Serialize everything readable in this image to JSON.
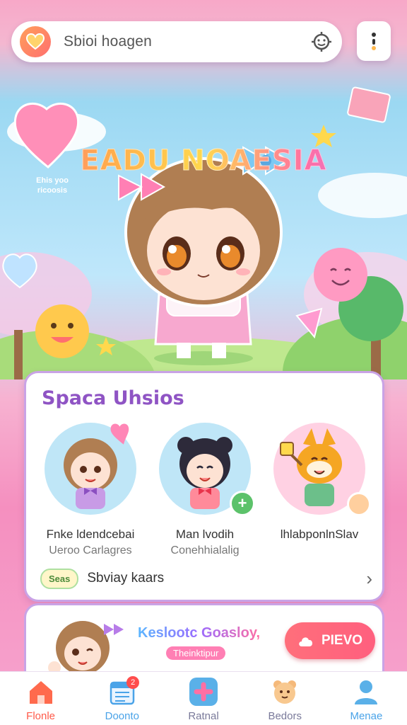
{
  "search": {
    "text": "Sbioi hoagen"
  },
  "hero": {
    "title": "EADU NOAESIA",
    "heart_badge": "Ehis yoo ricoosis"
  },
  "section": {
    "title": "Spaca Uhsios",
    "characters": [
      {
        "name": "Fnke ldendcebai",
        "sub": "Ueroo Carlagres"
      },
      {
        "name": "Man lvodih",
        "sub": "Conehhialalig"
      },
      {
        "name": "lhlabponlnSlav",
        "sub": ""
      }
    ],
    "tag": "Seas",
    "footer_label": "Sbviay kaars"
  },
  "banner": {
    "title": "Keslootc Goasloy,",
    "subtitle": "Theinktipur",
    "button": "PIEVO"
  },
  "tabs": [
    {
      "label": "Flonle",
      "color": "#ff5a4a",
      "icon": "home-icon"
    },
    {
      "label": "Doonto",
      "color": "#4aa3e8",
      "icon": "calendar-icon",
      "badge": "2"
    },
    {
      "label": "Ratnal",
      "color": "#7a7a9a",
      "icon": "add-icon"
    },
    {
      "label": "Bedors",
      "color": "#7a7a9a",
      "icon": "bear-icon"
    },
    {
      "label": "Menae",
      "color": "#4aa3e8",
      "icon": "profile-icon"
    }
  ],
  "colors": {
    "accent": "#8f54c4",
    "pink": "#ff6f9f",
    "blue": "#4aa3e8"
  }
}
